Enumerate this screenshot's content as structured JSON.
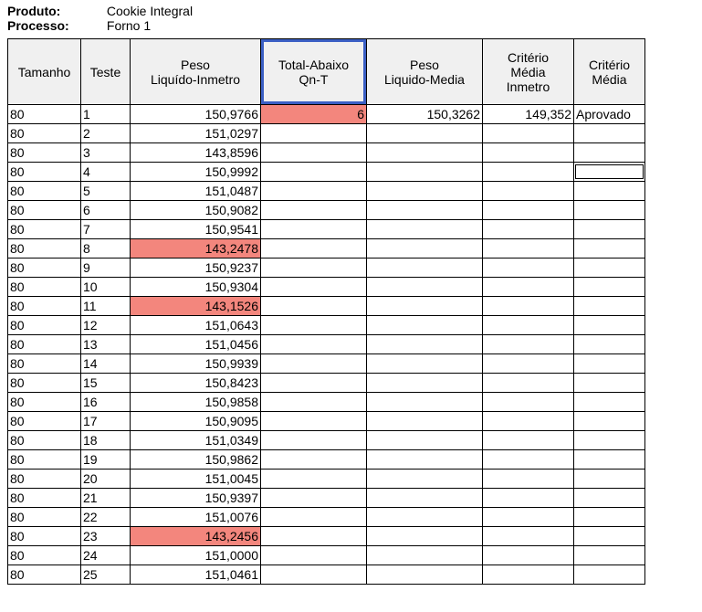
{
  "meta": {
    "product_label": "Produto:",
    "product_value": "Cookie Integral",
    "process_label": "Processo:",
    "process_value": "Forno 1"
  },
  "headers": {
    "tamanho": "Tamanho",
    "teste": "Teste",
    "peso_liq_in": "Peso\nLiquído-Inmetro",
    "total_abaixo": "Total-Abaixo\nQn-T",
    "peso_liq_media": "Peso\nLiquido-Media",
    "crit_media_in": "Critério\nMédia\nInmetro",
    "crit_media": "Critério\nMédia"
  },
  "summary": {
    "qn_t": "6",
    "media": "150,3262",
    "crit_in": "149,352",
    "crit": "Aprovado"
  },
  "rows": [
    {
      "tam": "80",
      "test": "1",
      "peso": "150,9766",
      "hl": false
    },
    {
      "tam": "80",
      "test": "2",
      "peso": "151,0297",
      "hl": false
    },
    {
      "tam": "80",
      "test": "3",
      "peso": "143,8596",
      "hl": false
    },
    {
      "tam": "80",
      "test": "4",
      "peso": "150,9992",
      "hl": false,
      "inner_box": true
    },
    {
      "tam": "80",
      "test": "5",
      "peso": "151,0487",
      "hl": false
    },
    {
      "tam": "80",
      "test": "6",
      "peso": "150,9082",
      "hl": false
    },
    {
      "tam": "80",
      "test": "7",
      "peso": "150,9541",
      "hl": false
    },
    {
      "tam": "80",
      "test": "8",
      "peso": "143,2478",
      "hl": true
    },
    {
      "tam": "80",
      "test": "9",
      "peso": "150,9237",
      "hl": false
    },
    {
      "tam": "80",
      "test": "10",
      "peso": "150,9304",
      "hl": false
    },
    {
      "tam": "80",
      "test": "11",
      "peso": "143,1526",
      "hl": true
    },
    {
      "tam": "80",
      "test": "12",
      "peso": "151,0643",
      "hl": false
    },
    {
      "tam": "80",
      "test": "13",
      "peso": "151,0456",
      "hl": false
    },
    {
      "tam": "80",
      "test": "14",
      "peso": "150,9939",
      "hl": false
    },
    {
      "tam": "80",
      "test": "15",
      "peso": "150,8423",
      "hl": false
    },
    {
      "tam": "80",
      "test": "16",
      "peso": "150,9858",
      "hl": false
    },
    {
      "tam": "80",
      "test": "17",
      "peso": "150,9095",
      "hl": false
    },
    {
      "tam": "80",
      "test": "18",
      "peso": "151,0349",
      "hl": false
    },
    {
      "tam": "80",
      "test": "19",
      "peso": "150,9862",
      "hl": false
    },
    {
      "tam": "80",
      "test": "20",
      "peso": "151,0045",
      "hl": false
    },
    {
      "tam": "80",
      "test": "21",
      "peso": "150,9397",
      "hl": false
    },
    {
      "tam": "80",
      "test": "22",
      "peso": "151,0076",
      "hl": false
    },
    {
      "tam": "80",
      "test": "23",
      "peso": "143,2456",
      "hl": true
    },
    {
      "tam": "80",
      "test": "24",
      "peso": "151,0000",
      "hl": false
    },
    {
      "tam": "80",
      "test": "25",
      "peso": "151,0461",
      "hl": false
    }
  ]
}
